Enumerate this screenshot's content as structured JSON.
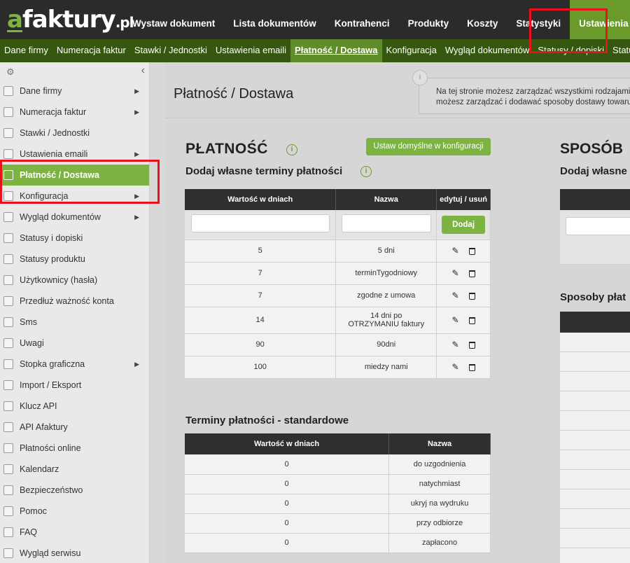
{
  "logo": {
    "a": "a",
    "rest": "faktury",
    "pl": ".pl"
  },
  "topnav": [
    "Wystaw dokument",
    "Lista dokumentów",
    "Kontrahenci",
    "Produkty",
    "Koszty",
    "Statystyki",
    "Ustawienia"
  ],
  "subnav": [
    "Dane firmy",
    "Numeracja faktur",
    "Stawki / Jednostki",
    "Ustawienia emaili",
    "Płatność / Dostawa",
    "Konfiguracja",
    "Wygląd dokumentów",
    "Statusy / dopiski",
    "Statusy pr"
  ],
  "sidebar": [
    {
      "label": "Dane firmy",
      "arrow": "▶"
    },
    {
      "label": "Numeracja faktur",
      "arrow": "▶"
    },
    {
      "label": "Stawki / Jednostki",
      "arrow": ""
    },
    {
      "label": "Ustawienia emaili",
      "arrow": "▶"
    },
    {
      "label": "Płatność / Dostawa",
      "arrow": ""
    },
    {
      "label": "Konfiguracja",
      "arrow": "▶"
    },
    {
      "label": "Wygląd dokumentów",
      "arrow": "▶"
    },
    {
      "label": "Statusy i dopiski",
      "arrow": ""
    },
    {
      "label": "Statusy produktu",
      "arrow": ""
    },
    {
      "label": "Użytkownicy (hasła)",
      "arrow": ""
    },
    {
      "label": "Przedłuż ważność konta",
      "arrow": ""
    },
    {
      "label": "Sms",
      "arrow": ""
    },
    {
      "label": "Uwagi",
      "arrow": ""
    },
    {
      "label": "Stopka graficzna",
      "arrow": "▶"
    },
    {
      "label": "Import / Eksport",
      "arrow": ""
    },
    {
      "label": "Klucz API",
      "arrow": ""
    },
    {
      "label": "API Afaktury",
      "arrow": ""
    },
    {
      "label": "Płatności online",
      "arrow": ""
    },
    {
      "label": "Kalendarz",
      "arrow": ""
    },
    {
      "label": "Bezpieczeństwo",
      "arrow": ""
    },
    {
      "label": "Pomoc",
      "arrow": ""
    },
    {
      "label": "FAQ",
      "arrow": ""
    },
    {
      "label": "Wygląd serwisu",
      "arrow": ""
    }
  ],
  "page": {
    "title": "Płatność / Dostawa",
    "info_line1": "Na tej stronie możesz zarządzać wszystkimi rodzajami",
    "info_line2": "możesz zarządzać i dodawać sposoby dostawy towaru."
  },
  "payment": {
    "heading": "PŁATNOŚĆ",
    "defaults_button": "Ustaw domyślne w konfiguracji",
    "custom_heading": "Dodaj własne terminy płatności",
    "columns": [
      "Wartość w dniach",
      "Nazwa",
      "edytuj / usuń"
    ],
    "add_button": "Dodaj",
    "rows": [
      {
        "days": "5",
        "name": "5 dni"
      },
      {
        "days": "7",
        "name": "terminTygodniowy"
      },
      {
        "days": "7",
        "name": "zgodne z umowa"
      },
      {
        "days": "14",
        "name": "14 dni po OTRZYMANIU faktury"
      },
      {
        "days": "90",
        "name": "90dni"
      },
      {
        "days": "100",
        "name": "miedzy nami"
      }
    ],
    "standard_heading": "Terminy płatności - standardowe",
    "standard_columns": [
      "Wartość w dniach",
      "Nazwa"
    ],
    "standard_rows": [
      {
        "days": "0",
        "name": "do uzgodnienia"
      },
      {
        "days": "0",
        "name": "natychmiast"
      },
      {
        "days": "0",
        "name": "ukryj na wydruku"
      },
      {
        "days": "0",
        "name": "przy odbiorze"
      },
      {
        "days": "0",
        "name": "zapłacono"
      }
    ]
  },
  "delivery": {
    "heading": "SPOSÓB",
    "custom_heading": "Dodaj własne",
    "methods_heading": "Sposoby płat"
  }
}
